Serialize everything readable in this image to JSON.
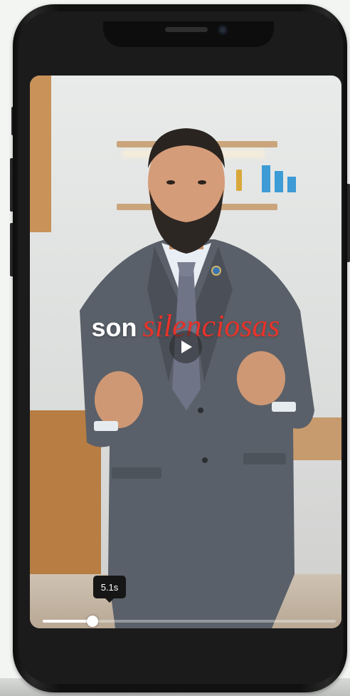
{
  "video": {
    "caption_word": "son",
    "caption_accent": "silenciosas",
    "play_icon": "play-icon",
    "current_time_label": "5.1s",
    "progress_fraction": 0.17
  },
  "colors": {
    "caption_accent": "#e8332b",
    "caption_text": "#ffffff",
    "phone_frame": "#111111"
  }
}
